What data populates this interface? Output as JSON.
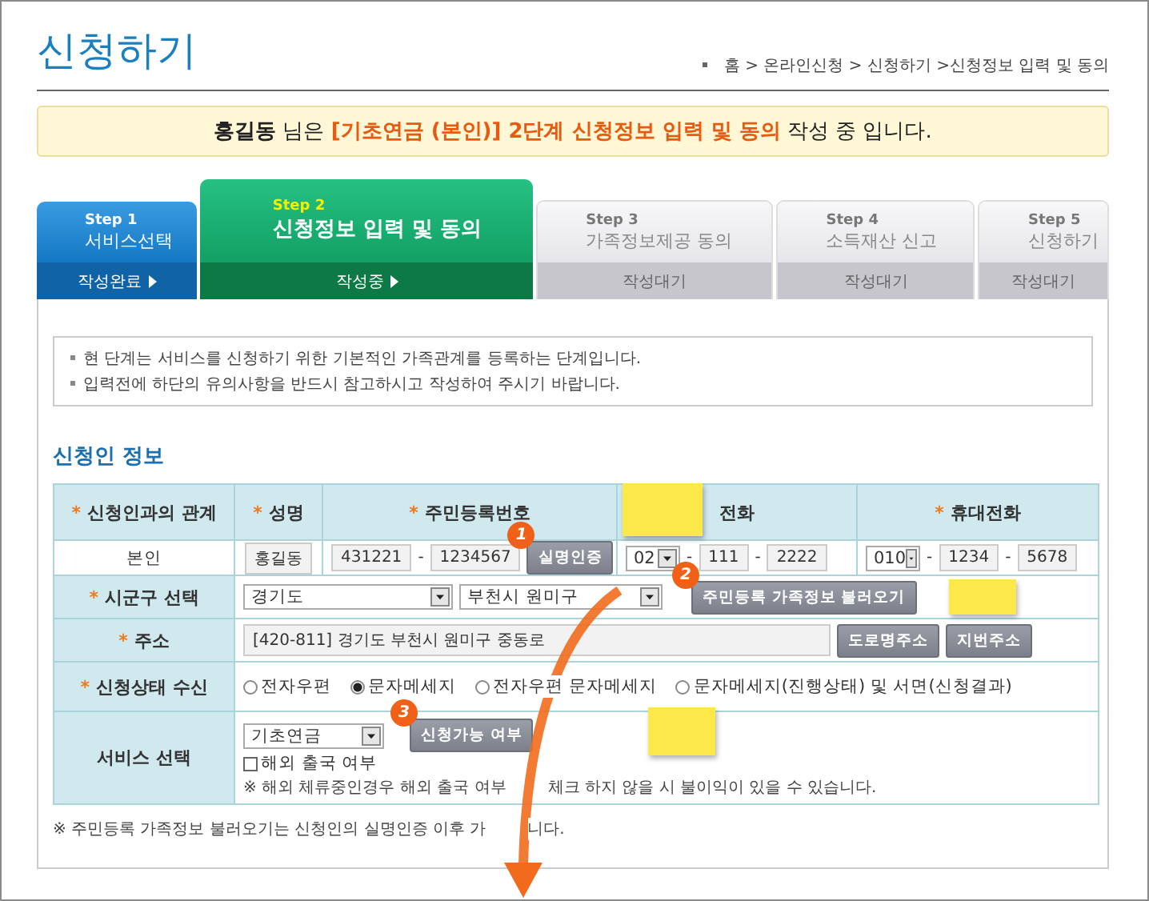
{
  "page_title": "신청하기",
  "breadcrumb": "홈 > 온라인신청 > 신청하기 >신청정보 입력 및 동의",
  "banner": {
    "name": "홍길동",
    "middle": "님은",
    "highlight": "[기초연금 (본인)] 2단계 신청정보 입력 및 동의",
    "tail": "작성 중 입니다."
  },
  "steps": [
    {
      "step": "Step 1",
      "label": "서비스선택",
      "status": "작성완료",
      "kind": "done"
    },
    {
      "step": "Step 2",
      "label": "신청정보 입력 및 동의",
      "status": "작성중",
      "kind": "current"
    },
    {
      "step": "Step 3",
      "label": "가족정보제공 동의",
      "status": "작성대기",
      "kind": "waiting"
    },
    {
      "step": "Step 4",
      "label": "소득재산 신고",
      "status": "작성대기",
      "kind": "waiting"
    },
    {
      "step": "Step 5",
      "label": "신청하기",
      "status": "작성대기",
      "kind": "waiting"
    }
  ],
  "notice": [
    "현 단계는 서비스를 신청하기 위한 기본적인 가족관계를 등록하는 단계입니다.",
    "입력전에 하단의 유의사항을 반드시 참고하시고 작성하여 주시기 바랍니다."
  ],
  "section_title": "신청인 정보",
  "table": {
    "columns": [
      {
        "mark": "*",
        "label": "신청인과의 관계"
      },
      {
        "mark": "*",
        "label": "성명"
      },
      {
        "mark": "*",
        "label": "주민등록번호"
      },
      {
        "label": "전화"
      },
      {
        "mark": "*",
        "label": "휴대전화"
      }
    ],
    "applicant": {
      "relation": "본인",
      "name": "홍길동",
      "rrn": [
        {
          "kind": "input",
          "value": "431221"
        },
        {
          "kind": "dash",
          "value": "-"
        },
        {
          "kind": "input",
          "value": "1234567"
        }
      ],
      "verify_button": {
        "label": "실명인증",
        "marker": "1"
      },
      "phone": [
        {
          "kind": "select",
          "value": "02"
        },
        {
          "kind": "dash",
          "value": "-"
        },
        {
          "kind": "input",
          "value": "111"
        },
        {
          "kind": "dash",
          "value": "-"
        },
        {
          "kind": "input",
          "value": "2222"
        }
      ],
      "mobile": [
        {
          "kind": "select",
          "value": "010"
        },
        {
          "kind": "dash",
          "value": "-"
        },
        {
          "kind": "input",
          "value": "1234"
        },
        {
          "kind": "dash",
          "value": "-"
        },
        {
          "kind": "input",
          "value": "5678"
        }
      ]
    },
    "region": {
      "mark": "*",
      "label": "시군구 선택",
      "province": "경기도",
      "city": "부천시 원미구",
      "button": {
        "label": "주민등록 가족정보 불러오기",
        "marker": "2"
      }
    },
    "address": {
      "mark": "*",
      "label": "주소",
      "value": "[420-811] 경기도 부천시 원미구 중동로",
      "buttons": [
        "도로명주소",
        "지번주소"
      ]
    },
    "notification": {
      "mark": "*",
      "label": "신청상태 수신",
      "options": [
        {
          "label": "전자우편",
          "selected": false
        },
        {
          "label": "문자메세지",
          "selected": true
        },
        {
          "label": "전자우편 문자메세지",
          "selected": false
        },
        {
          "label": "문자메세지(진행상태) 및 서면(신청결과)",
          "selected": false
        }
      ]
    },
    "service": {
      "label": "서비스 선택",
      "value": "기초연금",
      "button": {
        "label": "신청가능 여부",
        "marker": "3"
      },
      "overseas": {
        "label": "해외 출국 여부",
        "checked": false
      },
      "note": [
        "※ 해외 체류중인경우 해외 출국 여부",
        "체크 하지 않을 시 불이익이 있을 수 있습니다."
      ]
    }
  },
  "footer_note": [
    "※ 주민등록 가족정보 불러오기는 신청인의 실명인증 이후 가",
    "니다."
  ]
}
